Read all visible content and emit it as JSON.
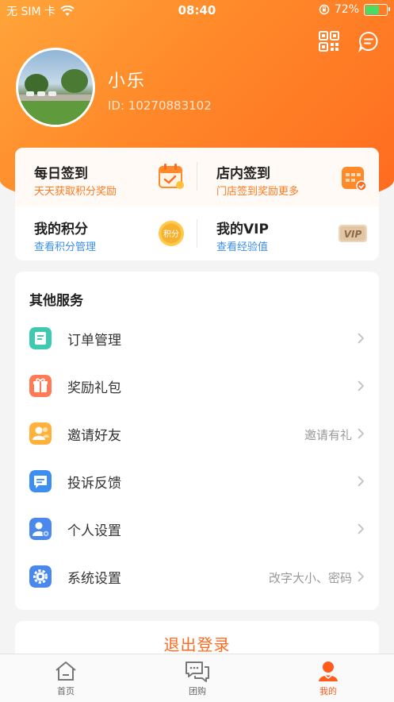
{
  "status_bar": {
    "carrier": "无 SIM 卡",
    "time": "08:40",
    "battery": "72%",
    "battery_level": 0.72
  },
  "header": {
    "qr_icon": "qr-code-icon",
    "message_icon": "message-icon"
  },
  "profile": {
    "name": "小乐",
    "id_text": "ID: 10270883102"
  },
  "quick_actions": [
    {
      "title": "每日签到",
      "subtitle": "天天获取积分奖励",
      "icon": "calendar-check-icon"
    },
    {
      "title": "店内签到",
      "subtitle": "门店签到奖励更多",
      "icon": "store-calendar-icon"
    },
    {
      "title": "我的积分",
      "subtitle": "查看积分管理",
      "icon": "points-coin-icon",
      "badge": "积分"
    },
    {
      "title": "我的VIP",
      "subtitle": "查看经验值",
      "icon": "vip-card-icon",
      "badge": "VIP"
    }
  ],
  "services": {
    "title": "其他服务",
    "items": [
      {
        "label": "订单管理",
        "hint": "",
        "icon": "order-icon",
        "color": "#3fc9b0"
      },
      {
        "label": "奖励礼包",
        "hint": "",
        "icon": "gift-icon",
        "color": "#ff7a55"
      },
      {
        "label": "邀请好友",
        "hint": "邀请有礼",
        "icon": "invite-icon",
        "color": "#ffb13b"
      },
      {
        "label": "投诉反馈",
        "hint": "",
        "icon": "feedback-icon",
        "color": "#3c8ff0"
      },
      {
        "label": "个人设置",
        "hint": "",
        "icon": "user-settings-icon",
        "color": "#4a88ee"
      },
      {
        "label": "系统设置",
        "hint": "改字大小、密码",
        "icon": "settings-gear-icon",
        "color": "#4a88ee"
      }
    ]
  },
  "logout": {
    "label": "退出登录"
  },
  "tabbar": {
    "items": [
      {
        "label": "首页",
        "icon": "home-icon",
        "active": false
      },
      {
        "label": "团购",
        "icon": "chat-bubbles-icon",
        "active": false
      },
      {
        "label": "我的",
        "icon": "person-icon",
        "active": true
      }
    ]
  },
  "colors": {
    "accent": "#ff6a1f",
    "header_gradient_start": "#ffa53a",
    "header_gradient_end": "#ff6a1f",
    "subtitle_orange": "#ff7a1f",
    "subtitle_blue": "#3c8ff0"
  }
}
